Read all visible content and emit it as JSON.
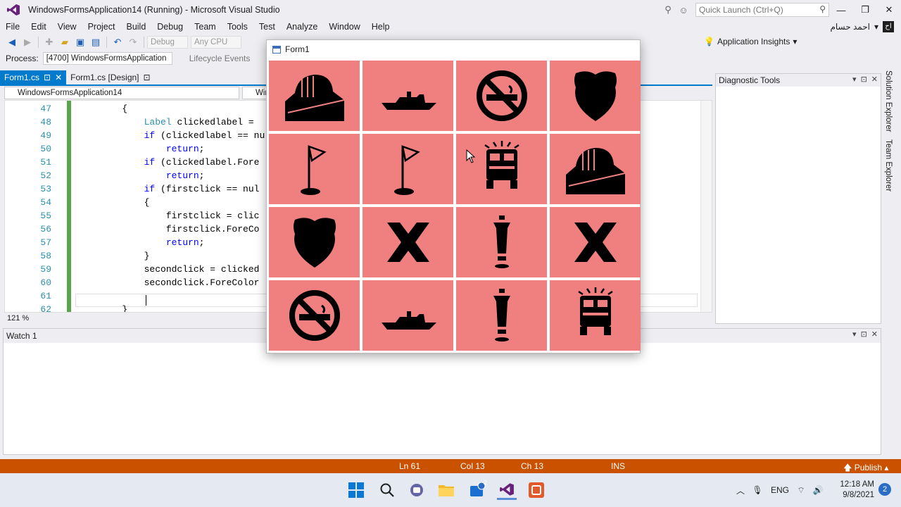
{
  "window": {
    "title": "WindowsFormsApplication14 (Running) - Microsoft Visual Studio",
    "quick_launch_placeholder": "Quick Launch (Ctrl+Q)"
  },
  "menu": [
    "File",
    "Edit",
    "View",
    "Project",
    "Build",
    "Debug",
    "Team",
    "Tools",
    "Test",
    "Analyze",
    "Window",
    "Help"
  ],
  "user": {
    "name": "احمد حسام",
    "badge": "اح"
  },
  "toolbar": {
    "config": "Debug",
    "platform": "Any CPU",
    "app_insights": "Application Insights",
    "process_label": "Process:",
    "process_value": "[4700] WindowsFormsApplication",
    "lifecycle": "Lifecycle Events"
  },
  "editor": {
    "tabs": [
      {
        "label": "Form1.cs",
        "active": true
      },
      {
        "label": "Form1.cs [Design]",
        "active": false
      }
    ],
    "nav_left": "WindowsFormsApplication14",
    "nav_right": "Wir",
    "zoom": "121 %",
    "lines": [
      {
        "num": "47",
        "text": "        {"
      },
      {
        "num": "48",
        "text": "            Label clickedlabel = "
      },
      {
        "num": "49",
        "text": "            if (clickedlabel == nu"
      },
      {
        "num": "50",
        "text": "                return;"
      },
      {
        "num": "51",
        "text": "            if (clickedlabel.Fore"
      },
      {
        "num": "52",
        "text": "                return;"
      },
      {
        "num": "53",
        "text": "            if (firstclick == nul"
      },
      {
        "num": "54",
        "text": "            {"
      },
      {
        "num": "55",
        "text": "                firstclick = clic"
      },
      {
        "num": "56",
        "text": "                firstclick.ForeCo"
      },
      {
        "num": "57",
        "text": "                return;"
      },
      {
        "num": "58",
        "text": "            }"
      },
      {
        "num": "59",
        "text": "            secondclick = clicked"
      },
      {
        "num": "60",
        "text": "            secondclick.ForeColor"
      },
      {
        "num": "61",
        "text": ""
      },
      {
        "num": "62",
        "text": "        }"
      }
    ]
  },
  "panels": {
    "diagnostic_tools": "Diagnostic Tools",
    "watch": "Watch 1",
    "side_tabs": [
      "Solution Explorer",
      "Team Explorer"
    ]
  },
  "form": {
    "title": "Form1",
    "cells": [
      "train",
      "ship",
      "no-smoking",
      "shield",
      "flag",
      "flag",
      "fire-truck",
      "train",
      "shield",
      "x",
      "person",
      "x",
      "no-smoking",
      "ship",
      "person",
      "fire-truck"
    ],
    "cell_color": "#f08080"
  },
  "status": {
    "ln": "Ln 61",
    "col": "Col 13",
    "ch": "Ch 13",
    "mode": "INS",
    "publish": "Publish",
    "color": "#ca5100"
  },
  "taskbar": {
    "lang": "ENG",
    "time": "12:18 AM",
    "date": "9/8/2021",
    "notifications": "2",
    "store_badge": "2"
  }
}
